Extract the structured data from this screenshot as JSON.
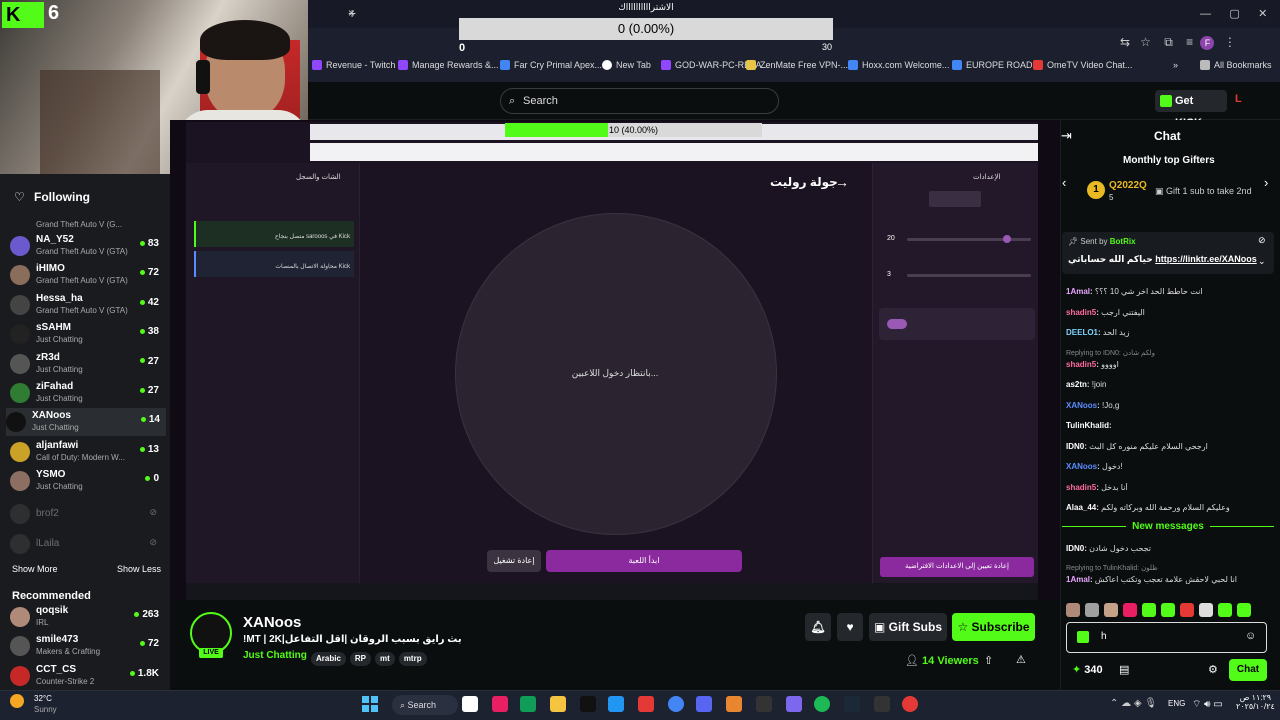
{
  "browser": {
    "tab_close": "×",
    "new_tab": "+",
    "bookmarks": [
      {
        "label": "Revenue - Twitch",
        "color": "#9146ff"
      },
      {
        "label": "Manage Rewards &...",
        "color": "#9146ff"
      },
      {
        "label": "Far Cry Primal Apex...",
        "color": "#4285f4"
      },
      {
        "label": "New Tab",
        "color": "#ffffff"
      },
      {
        "label": "GOD-WAR-PC-REPA...",
        "color": "#9146ff"
      },
      {
        "label": "ZenMate Free VPN-...",
        "color": "#e8c547"
      },
      {
        "label": "Hoxx.com Welcome...",
        "color": "#4285f4"
      },
      {
        "label": "EUROPE ROADS",
        "color": "#4285f4"
      },
      {
        "label": "OmeTV Video Chat...",
        "color": "#e53935"
      }
    ],
    "all_bookmarks": "All Bookmarks",
    "profile_initial": "F"
  },
  "poll": {
    "title": "الاشترااااااااااك",
    "result": "0 (0.00%)",
    "min": "0",
    "max": "30"
  },
  "header": {
    "search_placeholder": "Search",
    "get_kicks": "Get KICKs"
  },
  "webcam": {
    "overlay_number": "6"
  },
  "sidebar": {
    "following_label": "Following",
    "top_partial": "Grand Theft Auto V (G...",
    "items": [
      {
        "name": "NA_Y52",
        "game": "Grand Theft Auto V (GTA)",
        "count": "83",
        "color": "#6a5acd"
      },
      {
        "name": "iHIMO",
        "game": "Grand Theft Auto V (GTA)",
        "count": "72",
        "color": "#8a6d5a"
      },
      {
        "name": "Hessa_ha",
        "game": "Grand Theft Auto V (GTA)",
        "count": "42",
        "color": "#444"
      },
      {
        "name": "sSAHM",
        "game": "Just Chatting",
        "count": "38",
        "color": "#222"
      },
      {
        "name": "zR3d",
        "game": "Just Chatting",
        "count": "27",
        "color": "#555"
      },
      {
        "name": "ziFahad",
        "game": "Just Chatting",
        "count": "27",
        "color": "#2e7d32"
      },
      {
        "name": "XANoos",
        "game": "Just Chatting",
        "count": "14",
        "color": "#111"
      },
      {
        "name": "aljanfawi",
        "game": "Call of Duty: Modern W...",
        "count": "13",
        "color": "#c9a227"
      },
      {
        "name": "YSMO",
        "game": "Just Chatting",
        "count": "0",
        "color": "#8d6e63"
      }
    ],
    "offline": [
      "brof2",
      "lLaila"
    ],
    "show_more": "Show More",
    "show_less": "Show Less",
    "recommended_label": "Recommended",
    "recommended": [
      {
        "name": "qoqsik",
        "game": "IRL",
        "count": "263",
        "color": "#b08a78"
      },
      {
        "name": "smile473",
        "game": "Makers & Crafting",
        "count": "72",
        "color": "#555"
      },
      {
        "name": "CCT_CS",
        "game": "Counter-Strike 2",
        "count": "1.8K",
        "color": "#c62828"
      }
    ]
  },
  "stream_overlay": {
    "inner_poll": "10 (40.00%)",
    "inner_poll_fraction": 0.4,
    "roulette_title": "جولة روليت",
    "left_panel_title": "الشات والسجل",
    "waiting_players": "بانتظار دخول اللاعبين...",
    "start_game": "ابدأ اللعبة",
    "reset": "إعادة تشغيل",
    "settings_title": "الإعدادات",
    "setting_1_value": "20",
    "setting_2_value": "3",
    "reset_default": "إعادة تعيين إلى الاعدادات الافتراضية",
    "log_1": "متصل بنجاح sarooos في Kick",
    "log_2": "محاولة الاتصال بالمنصات Kick"
  },
  "stream_info": {
    "streamer": "XANoos",
    "title": "!MT | 2K|بث رايق بسبب الروقان |اقل التفاعل",
    "category": "Just Chatting",
    "tags": [
      "Arabic",
      "RP",
      "mt",
      "mtrp"
    ],
    "live_badge": "LIVE",
    "gift_subs": "Gift Subs",
    "subscribe": "Subscribe",
    "viewers_count": "14",
    "viewers_label": "Viewers"
  },
  "chat": {
    "title": "Chat",
    "gifters_title": "Monthly top Gifters",
    "top_gifter_rank": "1",
    "top_gifter_name": "Q2022Q",
    "top_gifter_count": "5",
    "gift_prompt": "Gift 1 sub to take 2nd",
    "pinned_sent_by": "Sent by",
    "pinned_bot": "BotRix",
    "pinned_text": "حياكم الله حساباتي",
    "pinned_link": "https://linktr.ee/XANoos",
    "messages": [
      {
        "user": "1Amal",
        "color": "#e8a5ff",
        "text": "انت حاطط الحد اخر شي 10 ؟؟؟"
      },
      {
        "user": "shadin5",
        "color": "#ff6b9d",
        "text": "اليفتني ارجب"
      },
      {
        "user": "DEELO1",
        "color": "#7fd3ff",
        "text": "زيد الحد"
      },
      {
        "user": "shadin5",
        "color": "#ff6b9d",
        "text": "اوووو",
        "reply": "Replying to IDN0: ولكم شادن"
      },
      {
        "user": "as2tn",
        "color": "#ffffff",
        "text": "!join"
      },
      {
        "user": "XANoos",
        "color": "#5b8cff",
        "text": "!Jo,g"
      },
      {
        "user": "TulinKhalid",
        "color": "#ffffff",
        "text": ""
      },
      {
        "user": "IDN0",
        "color": "#ffffff",
        "text": "ارجحي السلام عليكم منوره كل البث"
      },
      {
        "user": "XANoos",
        "color": "#5b8cff",
        "text": "دخول!"
      },
      {
        "user": "shadin5",
        "color": "#ff6b9d",
        "text": "أنا بدخل"
      },
      {
        "user": "Alaa_44",
        "color": "#ffffff",
        "text": "وعليكم السلام ورحمة الله وبركاته ولكم"
      }
    ],
    "new_messages": "New messages",
    "after_new": [
      {
        "user": "IDN0",
        "color": "#ffffff",
        "text": "تجحب دخول شادن"
      },
      {
        "user": "1Amal",
        "color": "#e8a5ff",
        "text": "انا لحبي لاحقش علامة تعجب وتكتب اعاكش",
        "reply": "Replying to TulinKhalid: ظلون"
      }
    ],
    "input_value": "h",
    "points": "340",
    "send_label": "Chat"
  },
  "taskbar": {
    "weather_temp": "32°C",
    "weather_desc": "Sunny",
    "search_label": "Search",
    "language": "ENG",
    "time": "١١:٢٩ ص",
    "date": "٢٠٢٥/١٠/٢٤"
  }
}
